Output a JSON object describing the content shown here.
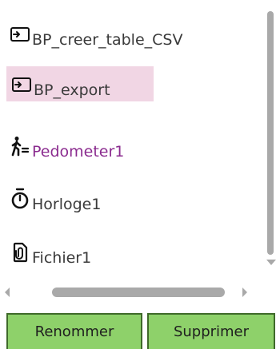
{
  "tree": {
    "items": [
      {
        "label": "BP_creer_table_CSV",
        "icon": "procedure-icon",
        "selected": false
      },
      {
        "label": "BP_export",
        "icon": "procedure-icon",
        "selected": true
      },
      {
        "label": "Pedometer1",
        "icon": "pedometer-icon",
        "selected": false
      },
      {
        "label": "Horloge1",
        "icon": "clock-icon",
        "selected": false
      },
      {
        "label": "Fichier1",
        "icon": "file-icon",
        "selected": false
      }
    ]
  },
  "buttons": {
    "rename_label": "Renommer",
    "delete_label": "Supprimer"
  },
  "colors": {
    "selection_bg": "#f1d6e4",
    "pedometer_text": "#8b2c8f",
    "button_bg": "#8ed16a",
    "button_border": "#3f6a2a",
    "scrollbar": "#a9a9a9"
  }
}
